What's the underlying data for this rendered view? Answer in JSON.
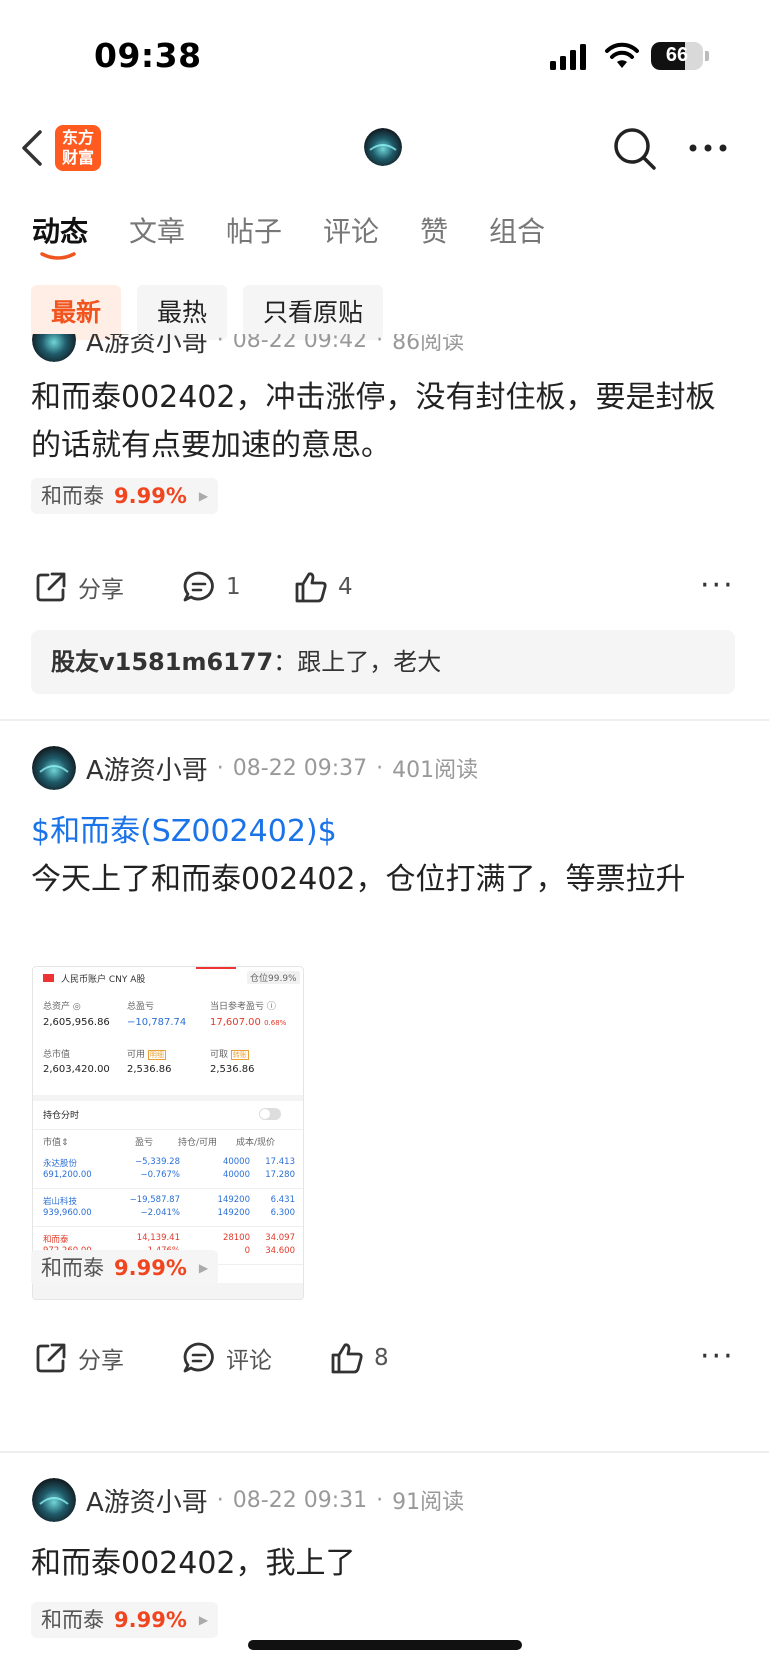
{
  "status_bar": {
    "time": "09:38",
    "battery": "66",
    "battery_level": 0.66
  },
  "nav": {
    "logo_line1": "东方",
    "logo_line2": "财富"
  },
  "tabs": [
    "动态",
    "文章",
    "帖子",
    "评论",
    "赞",
    "组合"
  ],
  "filters": [
    "最新",
    "最热",
    "只看原贴"
  ],
  "posts": [
    {
      "author": "A游资小哥",
      "time": "08-22 09:42",
      "reads": "86阅读",
      "text": "和而泰002402，冲击涨停，没有封住板，要是封板的话就有点要加速的意思。",
      "stock": {
        "name": "和而泰",
        "change": "9.99%"
      },
      "share": "分享",
      "comments": "1",
      "likes": "4",
      "reply": {
        "user": "股友v1581m6177",
        "text": "：跟上了，老大"
      }
    },
    {
      "author": "A游资小哥",
      "time": "08-22 09:37",
      "reads": "401阅读",
      "link": "$和而泰(SZ002402)$",
      "text": "今天上了和而泰002402，仓位打满了，等票拉升",
      "stock": {
        "name": "和而泰",
        "change": "9.99%"
      },
      "share": "分享",
      "comments": "评论",
      "likes": "8",
      "image": {
        "account": "人民币账户 CNY A股",
        "position": "仓位99.9%",
        "labels": {
          "total_assets": "总资产",
          "total_pnl": "总盈亏",
          "day_pnl": "当日参考盈亏",
          "market_value": "总市值",
          "available": "可用",
          "withdrawable": "可取",
          "detail": "明细",
          "transfer": "转账"
        },
        "total_assets": "2,605,956.86",
        "total_pnl": "−10,787.74",
        "day_pnl": "17,607.00",
        "day_pnl_pct": "0.68%",
        "market_value": "2,603,420.00",
        "available": "2,536.86",
        "withdrawable": "2,536.86",
        "holdings_title": "持仓分时",
        "headers": [
          "市值⇕",
          "盈亏",
          "持仓/可用",
          "成本/现价"
        ],
        "rows": [
          {
            "name": "永达股份",
            "value": "691,200.00",
            "pnl": "−5,339.28",
            "pnl_pct": "−0.767%",
            "qty": "40000",
            "avail": "40000",
            "cost": "17.413",
            "price": "17.280",
            "color": "#2a6fd6"
          },
          {
            "name": "岩山科技",
            "value": "939,960.00",
            "pnl": "−19,587.87",
            "pnl_pct": "−2.041%",
            "qty": "149200",
            "avail": "149200",
            "cost": "6.431",
            "price": "6.300",
            "color": "#2a6fd6"
          },
          {
            "name": "和而泰",
            "value": "972,260.00",
            "pnl": "14,139.41",
            "pnl_pct": "1.476%",
            "qty": "28100",
            "avail": "0",
            "cost": "34.097",
            "price": "34.600",
            "color": "#e03a2a"
          }
        ]
      }
    },
    {
      "author": "A游资小哥",
      "time": "08-22 09:31",
      "reads": "91阅读",
      "text": "和而泰002402，我上了",
      "stock": {
        "name": "和而泰",
        "change": "9.99%"
      }
    }
  ]
}
